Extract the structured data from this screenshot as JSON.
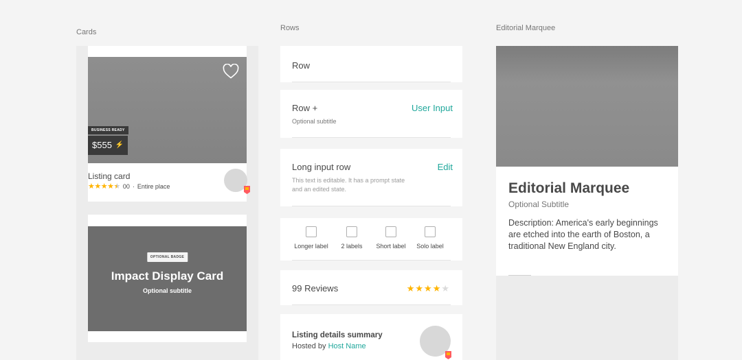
{
  "columns": {
    "cards": "Cards",
    "rows": "Rows",
    "editorial": "Editorial Marquee"
  },
  "listing_card": {
    "badge": "BUSINESS READY",
    "price": "$555",
    "title": "Listing card",
    "rating_stars": 4.5,
    "review_count": "00",
    "separator": "·",
    "room_type": "Entire place",
    "icons": [
      "heart-icon",
      "lightning-icon",
      "star-icon",
      "host-flag-icon"
    ],
    "colors": {
      "star": "#ffb400",
      "badge_bg": "#3a3a3a"
    }
  },
  "impact_card": {
    "badge": "OPTIONAL BADGE",
    "title": "Impact Display Card",
    "subtitle": "Optional subtitle"
  },
  "rows": {
    "basic": {
      "title": "Row"
    },
    "row_plus": {
      "title": "Row +",
      "subtitle": "Optional subtitle",
      "action": "User Input"
    },
    "long_input": {
      "title": "Long input row",
      "action": "Edit",
      "hint": "This text is editable. It has a prompt state and an edited state."
    },
    "checkboxes": [
      {
        "label": "Longer label"
      },
      {
        "label": "2 labels"
      },
      {
        "label": "Short label"
      },
      {
        "label": "Solo label"
      }
    ],
    "reviews": {
      "label": "99 Reviews",
      "stars_filled": 4,
      "stars_total": 5
    },
    "listing_summary": {
      "title": "Listing details summary",
      "hosted_by": "Hosted by",
      "host_name": "Host Name"
    },
    "colors": {
      "accent": "#1fa79b",
      "star": "#ffb400"
    }
  },
  "editorial": {
    "title": "Editorial Marquee",
    "subtitle": "Optional Subtitle",
    "description": "Description: America's early beginnings are etched into the earth of Boston, a traditional New England city."
  }
}
